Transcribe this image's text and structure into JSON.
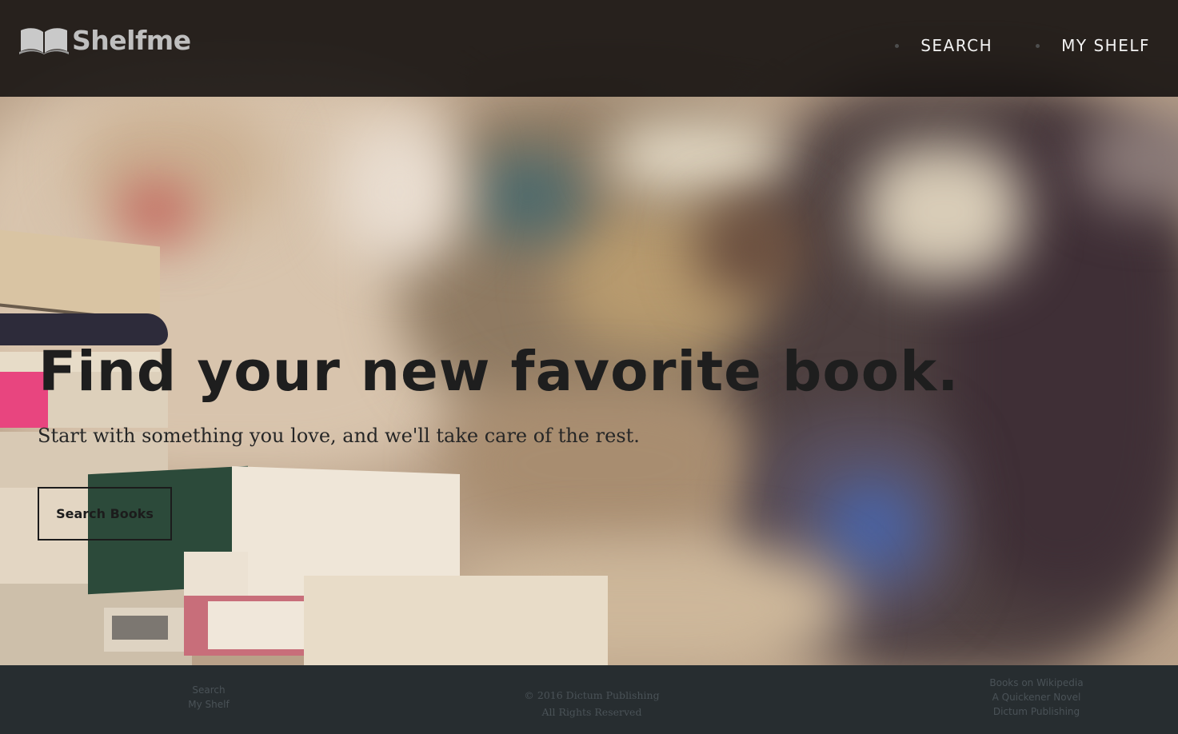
{
  "header": {
    "logo_text": "Shelfme",
    "logo_icon": "open-book-icon",
    "nav": [
      {
        "label": "SEARCH"
      },
      {
        "label": "MY SHELF"
      }
    ]
  },
  "hero": {
    "title": "Find your new favorite book.",
    "subtitle": "Start with something you love, and we'll take care of the rest.",
    "cta_label": "Search Books"
  },
  "footer": {
    "left_links": [
      "Search",
      "My Shelf"
    ],
    "copyright": "© 2016 Dictum Publishing",
    "rights": "All Rights Reserved",
    "right_links": [
      "Books on Wikipedia",
      "A Quickener Novel",
      "Dictum Publishing"
    ]
  },
  "colors": {
    "header_bg": "#120f0e",
    "footer_bg": "#272d30",
    "hero_text": "#1e1e1e",
    "nav_text": "#f2f2f2"
  }
}
